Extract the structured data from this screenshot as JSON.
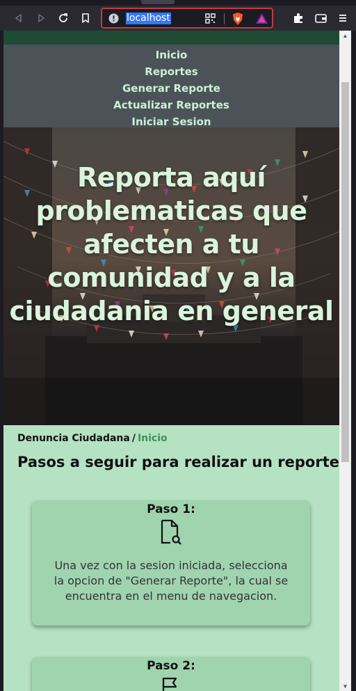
{
  "browser": {
    "url": "localhost"
  },
  "nav": {
    "items": [
      "Inicio",
      "Reportes",
      "Generar Reporte",
      "Actualizar Reportes",
      "Iniciar Sesion"
    ]
  },
  "hero": {
    "title": "Reporta aquí problematicas que afecten a tu comunidad y a la ciudadania en general"
  },
  "breadcrumb": {
    "root": "Denuncia Ciudadana",
    "separator": "/",
    "current": "Inicio"
  },
  "steps_section": {
    "title": "Pasos a seguir para realizar un reporte",
    "steps": [
      {
        "title": "Paso 1:",
        "icon": "file-search-icon",
        "text": "Una vez con la sesion iniciada, selecciona la opcion de \"Generar Reporte\", la cual se encuentra en el menu de navegacion."
      },
      {
        "title": "Paso 2:",
        "icon": "flag-icon",
        "text": ""
      }
    ]
  },
  "colors": {
    "page_bg": "#b5e2c2",
    "card_bg": "#9fd4ae",
    "nav_bg": "#4b5258",
    "nav_text": "#cdf0d4",
    "accent_green": "#3f8f5a",
    "url_border": "#c23b3b"
  }
}
